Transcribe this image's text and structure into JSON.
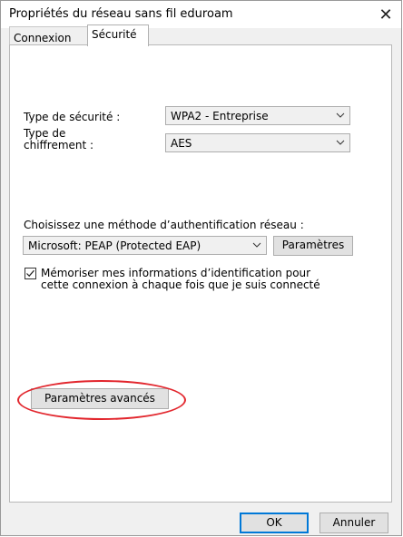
{
  "window": {
    "title": "Propriétés du réseau sans fil eduroam",
    "close_symbol": "✕"
  },
  "tabs": [
    {
      "label": "Connexion"
    },
    {
      "label": "Sécurité",
      "selected": true
    }
  ],
  "security": {
    "type_label": "Type de sécurité :",
    "type_value": "WPA2 - Entreprise",
    "cipher_label_1": "Type de",
    "cipher_label_2": "chiffrement :",
    "cipher_value": "AES"
  },
  "auth": {
    "method_label": "Choisissez une méthode d’authentification réseau :",
    "method_value": "Microsoft: PEAP (Protected EAP)",
    "params_button": "Paramètres",
    "remember_line1": "Mémoriser mes informations d’identification pour",
    "remember_line2": "cette connexion à chaque fois que je suis connecté",
    "remember_checked": true
  },
  "advanced": {
    "button": "Paramètres avancés",
    "highlight_color": "#e2262d"
  },
  "footer": {
    "ok": "OK",
    "cancel": "Annuler"
  },
  "icons": [
    "close-icon",
    "chevron-down-icon",
    "checkbox-checked-icon"
  ]
}
